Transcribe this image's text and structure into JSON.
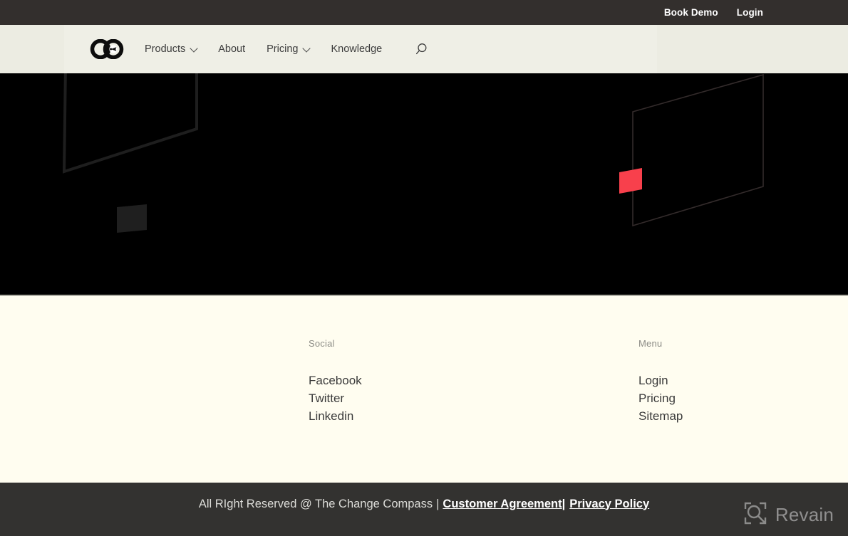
{
  "site": {
    "name": "The Change Compass",
    "logo_icon": "change-compass-logo-icon"
  },
  "topbar": {
    "links": [
      {
        "label": "Book Demo",
        "name": "book-demo"
      },
      {
        "label": "Login",
        "name": "login"
      }
    ]
  },
  "nav": {
    "items": [
      {
        "label": "Products",
        "has_dropdown": true
      },
      {
        "label": "About",
        "has_dropdown": false
      },
      {
        "label": "Pricing",
        "has_dropdown": true
      },
      {
        "label": "Knowledge",
        "has_dropdown": false
      }
    ],
    "search_icon": "search-icon"
  },
  "hero": {
    "background_color": "#000000",
    "accent_color": "#f8404c",
    "shapes": [
      {
        "name": "left-outlined-parallelogram",
        "style": "outline",
        "color": "#1e1e1e"
      },
      {
        "name": "left-filled-parallelogram",
        "style": "filled",
        "color": "#1f1f1f"
      },
      {
        "name": "right-outlined-parallelogram",
        "style": "outline",
        "color": "#2e2828"
      },
      {
        "name": "red-accent-parallelogram",
        "style": "filled",
        "color": "#f8404c"
      }
    ]
  },
  "footer": {
    "columns": [
      {
        "title": "Social",
        "links": [
          {
            "label": "Facebook"
          },
          {
            "label": "Twitter"
          },
          {
            "label": "Linkedin"
          }
        ]
      },
      {
        "title": "Menu",
        "links": [
          {
            "label": "Login"
          },
          {
            "label": "Pricing"
          },
          {
            "label": "Sitemap"
          }
        ]
      }
    ]
  },
  "copyright": {
    "plain_text": "All RIght Reserved @ The Change Compass",
    "separator": "|",
    "customer_agreement": "Customer Agreement",
    "agreement_separator": "|",
    "privacy_policy": "Privacy Policy"
  },
  "watermark": {
    "label": "Revain",
    "icon": "revain-logo-icon"
  },
  "colors": {
    "topbar_bg": "#332f2d",
    "nav_bg": "#ecece2",
    "nav_panel_bg": "#efefe6",
    "hero_bg": "#000000",
    "footer_bg": "#fffdf0",
    "copybar_bg": "#333230",
    "accent_red": "#f8404c",
    "nav_text": "#3c3c3c",
    "muted_text": "#8c8c86"
  }
}
